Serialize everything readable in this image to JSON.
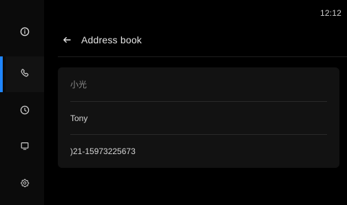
{
  "status": {
    "time": "12:12"
  },
  "rail": {
    "items": [
      {
        "icon": "info-icon",
        "active": false
      },
      {
        "icon": "phone-icon",
        "active": true
      },
      {
        "icon": "clock-icon",
        "active": false
      },
      {
        "icon": "screen-icon",
        "active": false
      },
      {
        "icon": "settings-icon",
        "active": false
      }
    ]
  },
  "header": {
    "title": "Address book"
  },
  "contact": {
    "group_label": "小光",
    "name": "Tony",
    "phone": ")21-15973225673"
  },
  "colors": {
    "accent": "#1f86ff",
    "background": "#000000",
    "card": "#121212"
  }
}
